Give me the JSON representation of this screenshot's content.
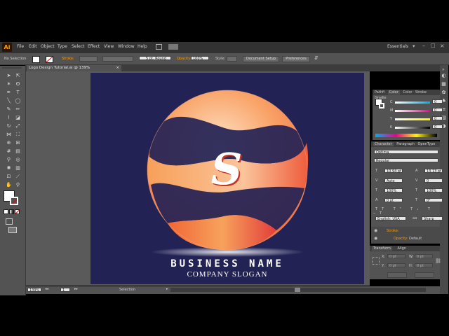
{
  "app": {
    "logo_text": "Ai"
  },
  "menu": [
    "File",
    "Edit",
    "Object",
    "Type",
    "Select",
    "Effect",
    "View",
    "Window",
    "Help"
  ],
  "workspace": "Essentials",
  "control": {
    "selection_label": "No Selection",
    "stroke_label": "Stroke:",
    "brush_value": "5 pt. Round",
    "opacity_label": "Opacity:",
    "opacity_value": "100%",
    "style_label": "Style:",
    "document_setup": "Document Setup",
    "preferences": "Preferences"
  },
  "document_tab": {
    "title": "Logo Design Tutorial.ai @ 139% (CMYK/Preview)",
    "close": "×"
  },
  "artwork": {
    "letter": "S",
    "business_name": "BUSINESS NAME",
    "slogan": "COMPANY SLOGAN",
    "colors": {
      "background": "#232255",
      "accent_orange": "#f7832a",
      "accent_red": "#e84a3a"
    }
  },
  "status": {
    "zoom": "139%",
    "page": "1",
    "tool": "Selection"
  },
  "color_panel": {
    "tabs": [
      "Pathfi",
      "Color",
      "Color",
      "Stroke",
      "Gradie"
    ],
    "channels": [
      {
        "label": "C",
        "value": "0"
      },
      {
        "label": "M",
        "value": "0"
      },
      {
        "label": "Y",
        "value": "0"
      },
      {
        "label": "K",
        "value": "0"
      }
    ]
  },
  "character_panel": {
    "tabs": [
      "Character",
      "Paragraph",
      "OpenType"
    ],
    "font_family": "Optima",
    "font_style": "Regular",
    "size": "10.94 pt",
    "leading": "13.13 pt",
    "kerning": "Auto",
    "tracking": "0",
    "vscale": "100%",
    "hscale": "100%",
    "baseline": "0 pt",
    "rotation": "0°",
    "language": "English: USA",
    "antialias": "Sharp"
  },
  "appearance": {
    "stroke_label": "Stroke:",
    "opacity_label": "Opacity:",
    "opacity_value": "Default"
  },
  "transform_panel": {
    "tabs": [
      "Transform",
      "Align"
    ],
    "x": "0 pt",
    "y": "0 pt",
    "w": "0 pt",
    "h": "0 pt"
  }
}
